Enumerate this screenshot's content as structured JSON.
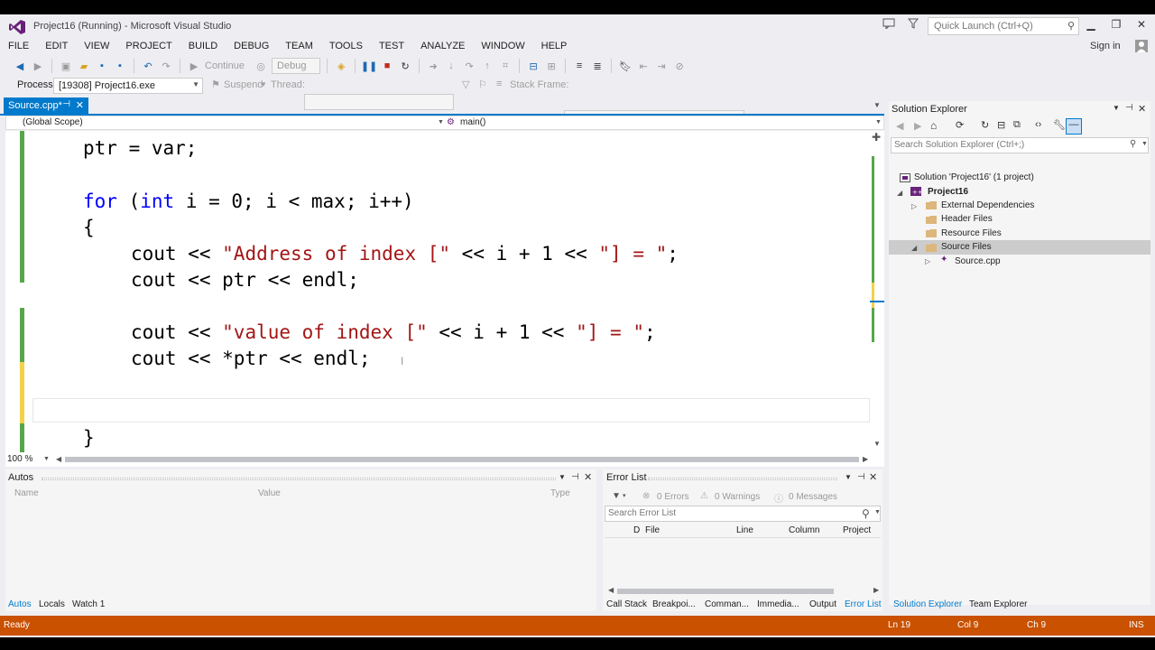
{
  "window": {
    "title": "Project16 (Running) - Microsoft Visual Studio",
    "quick_launch_placeholder": "Quick Launch (Ctrl+Q)",
    "sign_in": "Sign in"
  },
  "menu": [
    "FILE",
    "EDIT",
    "VIEW",
    "PROJECT",
    "BUILD",
    "DEBUG",
    "TEAM",
    "TOOLS",
    "TEST",
    "ANALYZE",
    "WINDOW",
    "HELP"
  ],
  "toolbar": {
    "continue": "Continue",
    "config": "Debug",
    "process_label": "Process:",
    "process_value": "[19308] Project16.exe",
    "suspend": "Suspend",
    "thread": "Thread:",
    "stack_frame": "Stack Frame:"
  },
  "editor": {
    "tab_name": "Source.cpp*",
    "scope_left": "(Global Scope)",
    "scope_right": "main()",
    "zoom": "100 %",
    "lines": {
      "l1": "ptr = var;",
      "l2a": "for",
      "l2b": " (",
      "l2c": "int",
      "l2d": " i = 0; i < max; i++)",
      "l3": "{",
      "l4a": "cout << ",
      "l4b": "\"Address of index [\"",
      "l4c": " << i + 1 << ",
      "l4d": "\"] = \"",
      "l4e": ";",
      "l5": "cout << ptr << endl;",
      "l6a": "cout << ",
      "l6b": "\"value of index [\"",
      "l6c": " << i + 1 << ",
      "l6d": "\"] = \"",
      "l6e": ";",
      "l7": "cout << *ptr << endl;",
      "l8": "}"
    }
  },
  "solution_explorer": {
    "title": "Solution Explorer",
    "search_placeholder": "Search Solution Explorer (Ctrl+;)",
    "items": {
      "solution": "Solution 'Project16' (1 project)",
      "project": "Project16",
      "external": "External Dependencies",
      "header": "Header Files",
      "resource": "Resource Files",
      "source": "Source Files",
      "sourcecpp": "Source.cpp"
    },
    "tabs": {
      "a": "Solution Explorer",
      "b": "Team Explorer"
    }
  },
  "autos": {
    "title": "Autos",
    "columns": {
      "name": "Name",
      "value": "Value",
      "type": "Type"
    },
    "tabs": {
      "a": "Autos",
      "b": "Locals",
      "c": "Watch 1"
    }
  },
  "error_list": {
    "title": "Error List",
    "errors": "0 Errors",
    "warnings": "0 Warnings",
    "messages": "0 Messages",
    "search_placeholder": "Search Error List",
    "columns": {
      "d": "D",
      "file": "File",
      "line": "Line",
      "column": "Column",
      "project": "Project"
    },
    "tabs": {
      "a": "Call Stack",
      "b": "Breakpoi...",
      "c": "Comman...",
      "d": "Immedia...",
      "e": "Output",
      "f": "Error List"
    }
  },
  "status": {
    "ready": "Ready",
    "ln": "Ln 19",
    "col": "Col 9",
    "ch": "Ch 9",
    "ins": "INS"
  },
  "colors": {
    "accent": "#007acc",
    "status_debug": "#ca5100",
    "keyword": "#0000ff",
    "string": "#a31515"
  }
}
